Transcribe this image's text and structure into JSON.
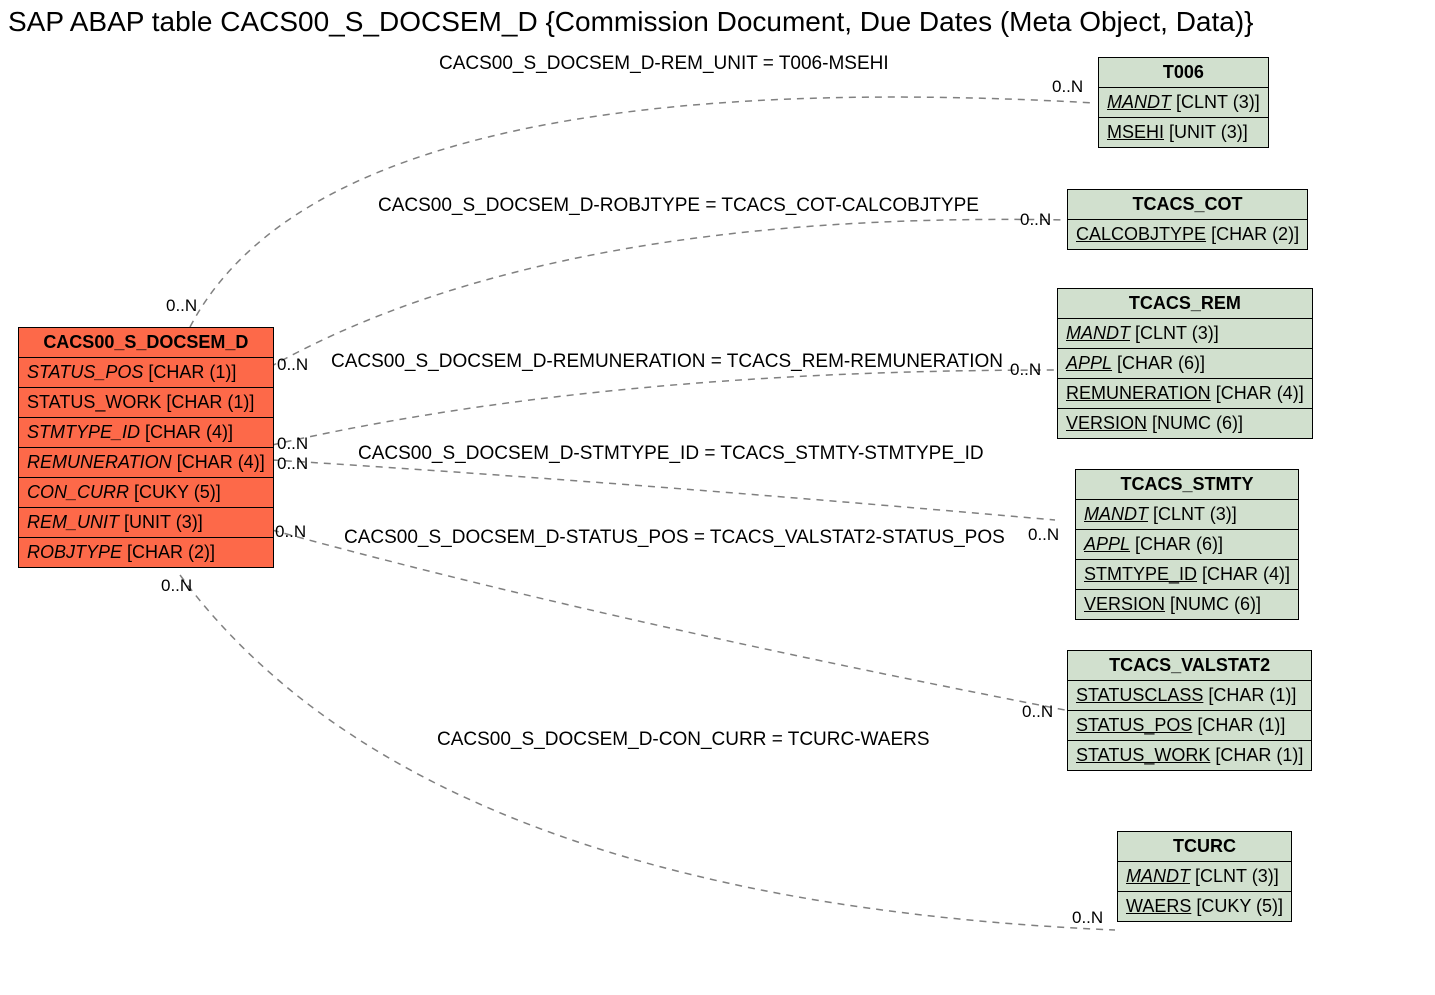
{
  "title": "SAP ABAP table CACS00_S_DOCSEM_D {Commission Document, Due Dates (Meta Object, Data)}",
  "main_entity": {
    "name": "CACS00_S_DOCSEM_D",
    "fields": [
      {
        "name": "STATUS_POS",
        "type": "[CHAR (1)]",
        "italic": true
      },
      {
        "name": "STATUS_WORK",
        "type": "[CHAR (1)]"
      },
      {
        "name": "STMTYPE_ID",
        "type": "[CHAR (4)]",
        "italic": true
      },
      {
        "name": "REMUNERATION",
        "type": "[CHAR (4)]",
        "italic": true
      },
      {
        "name": "CON_CURR",
        "type": "[CUKY (5)]",
        "italic": true
      },
      {
        "name": "REM_UNIT",
        "type": "[UNIT (3)]",
        "italic": true
      },
      {
        "name": "ROBJTYPE",
        "type": "[CHAR (2)]",
        "italic": true
      }
    ]
  },
  "ref_entities": [
    {
      "id": "t006",
      "name": "T006",
      "fields": [
        {
          "name": "MANDT",
          "type": "[CLNT (3)]",
          "underline": true,
          "italic": true
        },
        {
          "name": "MSEHI",
          "type": "[UNIT (3)]",
          "underline": true
        }
      ]
    },
    {
      "id": "tcacs_cot",
      "name": "TCACS_COT",
      "fields": [
        {
          "name": "CALCOBJTYPE",
          "type": "[CHAR (2)]",
          "underline": true
        }
      ]
    },
    {
      "id": "tcacs_rem",
      "name": "TCACS_REM",
      "fields": [
        {
          "name": "MANDT",
          "type": "[CLNT (3)]",
          "underline": true,
          "italic": true
        },
        {
          "name": "APPL",
          "type": "[CHAR (6)]",
          "underline": true,
          "italic": true
        },
        {
          "name": "REMUNERATION",
          "type": "[CHAR (4)]",
          "underline": true
        },
        {
          "name": "VERSION",
          "type": "[NUMC (6)]",
          "underline": true
        }
      ]
    },
    {
      "id": "tcacs_stmty",
      "name": "TCACS_STMTY",
      "fields": [
        {
          "name": "MANDT",
          "type": "[CLNT (3)]",
          "underline": true,
          "italic": true
        },
        {
          "name": "APPL",
          "type": "[CHAR (6)]",
          "underline": true,
          "italic": true
        },
        {
          "name": "STMTYPE_ID",
          "type": "[CHAR (4)]",
          "underline": true
        },
        {
          "name": "VERSION",
          "type": "[NUMC (6)]",
          "underline": true
        }
      ]
    },
    {
      "id": "tcacs_valstat2",
      "name": "TCACS_VALSTAT2",
      "fields": [
        {
          "name": "STATUSCLASS",
          "type": "[CHAR (1)]",
          "underline": true
        },
        {
          "name": "STATUS_POS",
          "type": "[CHAR (1)]",
          "underline": true
        },
        {
          "name": "STATUS_WORK",
          "type": "[CHAR (1)]",
          "underline": true
        }
      ]
    },
    {
      "id": "tcurc",
      "name": "TCURC",
      "fields": [
        {
          "name": "MANDT",
          "type": "[CLNT (3)]",
          "underline": true,
          "italic": true
        },
        {
          "name": "WAERS",
          "type": "[CUKY (5)]",
          "underline": true
        }
      ]
    }
  ],
  "relations": [
    {
      "label": "CACS00_S_DOCSEM_D-REM_UNIT = T006-MSEHI"
    },
    {
      "label": "CACS00_S_DOCSEM_D-ROBJTYPE = TCACS_COT-CALCOBJTYPE"
    },
    {
      "label": "CACS00_S_DOCSEM_D-REMUNERATION = TCACS_REM-REMUNERATION"
    },
    {
      "label": "CACS00_S_DOCSEM_D-STMTYPE_ID = TCACS_STMTY-STMTYPE_ID"
    },
    {
      "label": "CACS00_S_DOCSEM_D-STATUS_POS = TCACS_VALSTAT2-STATUS_POS"
    },
    {
      "label": "CACS00_S_DOCSEM_D-CON_CURR = TCURC-WAERS"
    }
  ],
  "card": "0..N"
}
